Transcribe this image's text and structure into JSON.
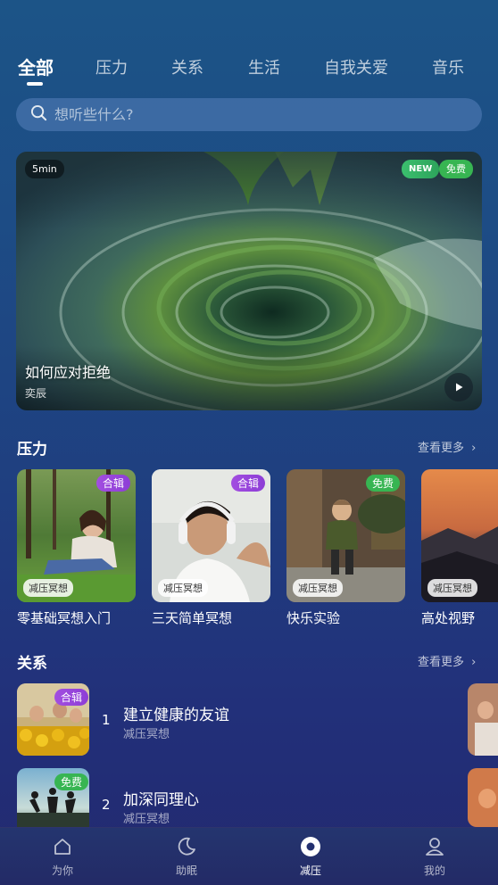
{
  "tabs": [
    {
      "label": "全部",
      "active": true
    },
    {
      "label": "压力",
      "active": false
    },
    {
      "label": "关系",
      "active": false
    },
    {
      "label": "生活",
      "active": false
    },
    {
      "label": "自我关爱",
      "active": false
    },
    {
      "label": "音乐",
      "active": false
    }
  ],
  "search": {
    "placeholder": "想听些什么?"
  },
  "hero": {
    "duration": "5min",
    "badge_new": "NEW",
    "badge_free": "免费",
    "title": "如何应对拒绝",
    "author": "奕辰"
  },
  "section_pressure": {
    "title": "压力",
    "more": "查看更多",
    "cards": [
      {
        "title": "零基础冥想入门",
        "tag_top": "合辑",
        "tag_bottom": "减压冥想"
      },
      {
        "title": "三天简单冥想",
        "tag_top": "合辑",
        "tag_bottom": "减压冥想"
      },
      {
        "title": "快乐实验",
        "tag_top": "免费",
        "tag_bottom": "减压冥想"
      },
      {
        "title": "高处视野",
        "tag_top": "",
        "tag_bottom": "减压冥想"
      }
    ]
  },
  "section_relation": {
    "title": "关系",
    "more": "查看更多",
    "items": [
      {
        "num": "1",
        "title": "建立健康的友谊",
        "sub": "减压冥想",
        "tag": "合辑"
      },
      {
        "num": "2",
        "title": "加深同理心",
        "sub": "减压冥想",
        "tag": "免费"
      }
    ]
  },
  "bottom_nav": [
    {
      "label": "为你",
      "icon": "home-icon",
      "active": false
    },
    {
      "label": "助眠",
      "icon": "moon-icon",
      "active": false
    },
    {
      "label": "减压",
      "icon": "circle-dot-icon",
      "active": true
    },
    {
      "label": "我的",
      "icon": "profile-icon",
      "active": false
    }
  ],
  "colors": {
    "tag_purple": "#9b46dc",
    "tag_green": "#37b552",
    "bg_top": "#1c5487",
    "bg_bottom": "#23296f"
  }
}
